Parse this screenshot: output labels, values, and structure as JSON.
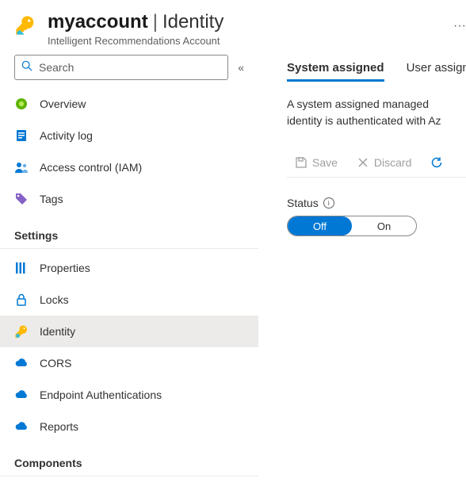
{
  "header": {
    "title_account": "myaccount",
    "title_separator": "|",
    "title_page": "Identity",
    "subtitle": "Intelligent Recommendations Account",
    "more": "···"
  },
  "search": {
    "placeholder": "Search",
    "collapse_glyph": "«"
  },
  "nav_top": [
    {
      "label": "Overview"
    },
    {
      "label": "Activity log"
    },
    {
      "label": "Access control (IAM)"
    },
    {
      "label": "Tags"
    }
  ],
  "sections": {
    "settings": {
      "header": "Settings",
      "items": [
        {
          "label": "Properties"
        },
        {
          "label": "Locks"
        },
        {
          "label": "Identity"
        },
        {
          "label": "CORS"
        },
        {
          "label": "Endpoint Authentications"
        },
        {
          "label": "Reports"
        }
      ]
    },
    "components": {
      "header": "Components"
    }
  },
  "main": {
    "tabs": [
      {
        "label": "System assigned",
        "active": true
      },
      {
        "label": "User assigned",
        "active": false
      }
    ],
    "description": "A system assigned managed identity is authenticated with Az",
    "toolbar": {
      "save": "Save",
      "discard": "Discard"
    },
    "status": {
      "label": "Status",
      "off": "Off",
      "on": "On",
      "value": "Off"
    }
  }
}
